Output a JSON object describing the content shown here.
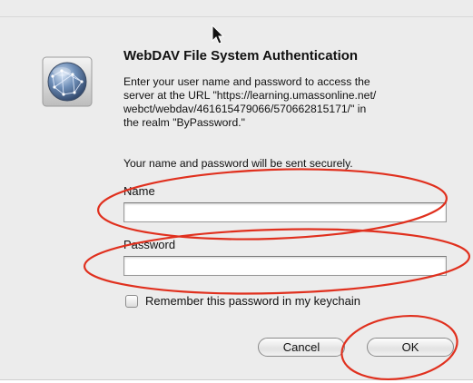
{
  "dialog": {
    "title": "WebDAV File System Authentication",
    "message": "Enter your user name and password to access the\nserver at the URL \"https://learning.umassonline.net/\nwebct/webdav/461615479066/570662815171/\" in\nthe realm \"ByPassword.\"",
    "secure_note": "Your name and password will be sent securely.",
    "icon": "network-globe-icon"
  },
  "name_field": {
    "label": "Name",
    "value": "",
    "placeholder": ""
  },
  "password_field": {
    "label": "Password",
    "value": "",
    "placeholder": ""
  },
  "remember": {
    "label": "Remember this password in my keychain",
    "checked": false
  },
  "buttons": {
    "cancel": "Cancel",
    "ok": "OK"
  },
  "annotation": {
    "color": "#e0301e"
  }
}
